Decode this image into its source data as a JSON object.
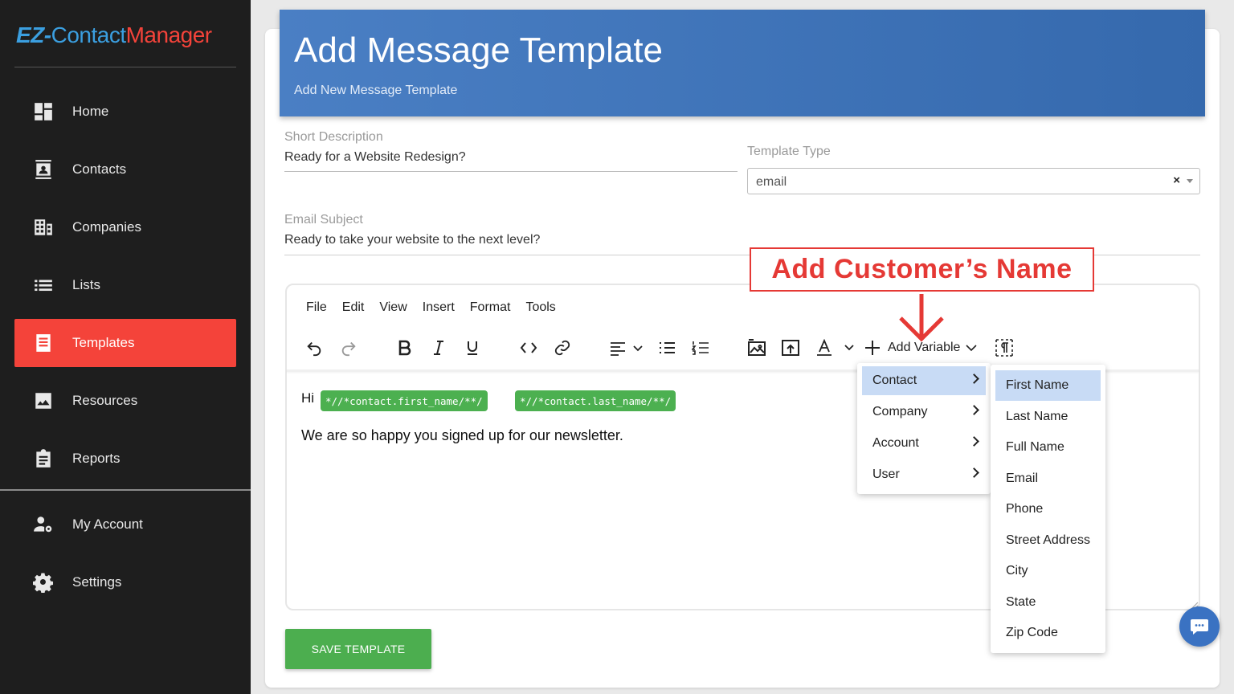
{
  "brand": {
    "ez": "EZ-",
    "contact": "Contact",
    "manager": "Manager"
  },
  "sidebar": {
    "items": [
      {
        "label": "Home",
        "icon": "dashboard-icon"
      },
      {
        "label": "Contacts",
        "icon": "contact-card-icon"
      },
      {
        "label": "Companies",
        "icon": "building-icon"
      },
      {
        "label": "Lists",
        "icon": "list-icon"
      },
      {
        "label": "Templates",
        "icon": "document-icon",
        "active": true
      },
      {
        "label": "Resources",
        "icon": "image-icon"
      },
      {
        "label": "Reports",
        "icon": "clipboard-icon"
      },
      {
        "label": "My Account",
        "icon": "user-gear-icon"
      },
      {
        "label": "Settings",
        "icon": "gear-icon"
      }
    ],
    "active_color": "#f4433a"
  },
  "header": {
    "title": "Add Message Template",
    "subtitle": "Add New Message Template"
  },
  "form": {
    "short_description": {
      "label": "Short Description",
      "value": "Ready for a Website Redesign?"
    },
    "template_type": {
      "label": "Template Type",
      "value": "email",
      "clear": "×"
    },
    "email_subject": {
      "label": "Email Subject",
      "value": "Ready to take your website to the next level?"
    }
  },
  "callout": {
    "text": "Add Customer’s Name",
    "color": "#e53935"
  },
  "editor": {
    "menu": [
      "File",
      "Edit",
      "View",
      "Insert",
      "Format",
      "Tools"
    ],
    "add_variable_label": "Add Variable",
    "content": {
      "greeting": "Hi",
      "chips": [
        "*//*contact.first_name/**/",
        "*//*contact.last_name/**/"
      ],
      "line": "We are so happy you signed up for our newsletter."
    }
  },
  "variable_menu": {
    "categories": [
      "Contact",
      "Company",
      "Account",
      "User"
    ],
    "active_category": "Contact",
    "contact_fields": [
      "First Name",
      "Last Name",
      "Full Name",
      "Email",
      "Phone",
      "Street Address",
      "City",
      "State",
      "Zip Code"
    ],
    "active_field": "First Name"
  },
  "actions": {
    "save_label": "SAVE TEMPLATE"
  },
  "colors": {
    "banner": "#3f74b9",
    "save": "#4cae4f",
    "chip": "#4cb050"
  }
}
